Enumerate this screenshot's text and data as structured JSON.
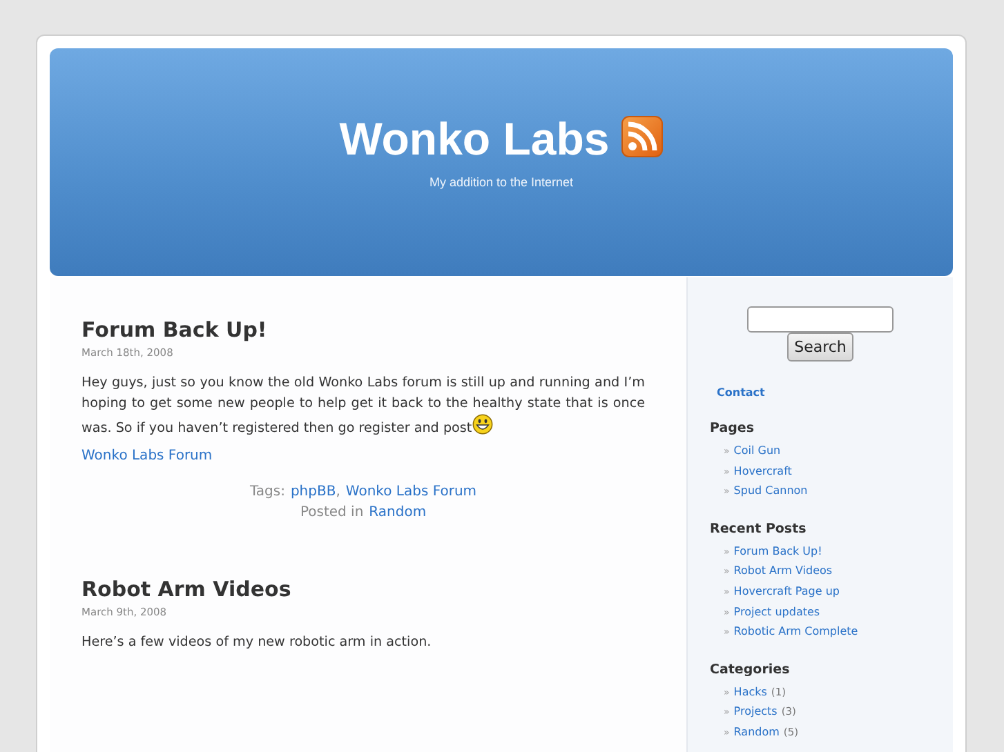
{
  "header": {
    "title": "Wonko Labs",
    "tagline": "My addition to the Internet"
  },
  "posts": [
    {
      "title": "Forum Back Up!",
      "date": "March 18th, 2008",
      "body": "Hey guys, just so you know the old Wonko Labs forum is still up and running and I’m hoping to get some new people to help get it back to the healthy state that is once was. So if you haven’t registered then go register and post",
      "smiley": true,
      "link": "Wonko Labs Forum",
      "tags_label": "Tags:",
      "tags": [
        {
          "label": "phpBB",
          "after": ","
        },
        {
          "label": "Wonko Labs Forum"
        }
      ],
      "posted_label": "Posted in",
      "category": "Random"
    },
    {
      "title": "Robot Arm Videos",
      "date": "March 9th, 2008",
      "body": "Here’s a few videos of my new robotic arm in action.",
      "smiley": false
    }
  ],
  "sidebar": {
    "bullet": "»",
    "search": {
      "button": "Search"
    },
    "contact": "Contact",
    "sections": [
      {
        "heading": "Pages",
        "items": [
          {
            "label": "Coil Gun"
          },
          {
            "label": "Hovercraft"
          },
          {
            "label": "Spud Cannon"
          }
        ]
      },
      {
        "heading": "Recent Posts",
        "items": [
          {
            "label": "Forum Back Up!"
          },
          {
            "label": "Robot Arm Videos"
          },
          {
            "label": "Hovercraft Page up"
          },
          {
            "label": "Project updates"
          },
          {
            "label": "Robotic Arm Complete"
          }
        ]
      },
      {
        "heading": "Categories",
        "items": [
          {
            "label": "Hacks",
            "count": "(1)"
          },
          {
            "label": "Projects",
            "count": "(3)"
          },
          {
            "label": "Random",
            "count": "(5)"
          }
        ]
      }
    ]
  }
}
